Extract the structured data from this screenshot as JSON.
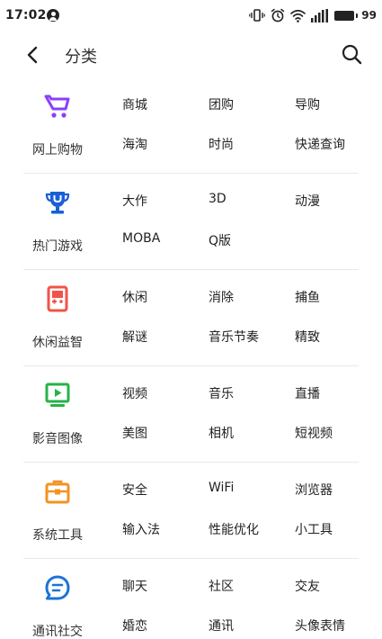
{
  "status_bar": {
    "time": "17:02",
    "battery": "99",
    "icons": [
      "account-icon",
      "vibrate-icon",
      "alarm-icon",
      "wifi-icon",
      "signal-icon",
      "battery-icon"
    ]
  },
  "header": {
    "title": "分类",
    "back_icon": "chevron-left-icon",
    "search_icon": "search-icon"
  },
  "categories": [
    {
      "name": "网上购物",
      "icon": "shopping-cart-icon",
      "color": "#8a3ffc",
      "items": [
        "商城",
        "团购",
        "导购",
        "海淘",
        "时尚",
        "快递查询"
      ]
    },
    {
      "name": "热门游戏",
      "icon": "trophy-icon",
      "color": "#1a5fd6",
      "items": [
        "大作",
        "3D",
        "动漫",
        "MOBA",
        "Q版"
      ]
    },
    {
      "name": "休闲益智",
      "icon": "game-card-icon",
      "color": "#f0534a",
      "items": [
        "休闲",
        "消除",
        "捕鱼",
        "解谜",
        "音乐节奏",
        "精致"
      ]
    },
    {
      "name": "影音图像",
      "icon": "video-play-icon",
      "color": "#26b24a",
      "items": [
        "视频",
        "音乐",
        "直播",
        "美图",
        "相机",
        "短视频"
      ]
    },
    {
      "name": "系统工具",
      "icon": "toolbox-icon",
      "color": "#f39322",
      "items": [
        "安全",
        "WiFi",
        "浏览器",
        "输入法",
        "性能优化",
        "小工具"
      ]
    },
    {
      "name": "通讯社交",
      "icon": "chat-bubble-icon",
      "color": "#1a73d9",
      "items": [
        "聊天",
        "社区",
        "交友",
        "婚恋",
        "通讯",
        "头像表情"
      ]
    }
  ]
}
